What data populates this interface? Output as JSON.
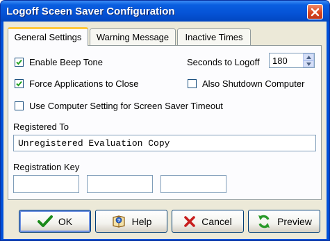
{
  "window": {
    "title": "Logoff Sceen Saver Configuration"
  },
  "tabs": [
    {
      "label": "General Settings",
      "active": true
    },
    {
      "label": "Warning Message",
      "active": false
    },
    {
      "label": "Inactive Times",
      "active": false
    }
  ],
  "general": {
    "enable_beep": {
      "label": "Enable Beep Tone",
      "checked": true
    },
    "force_close": {
      "label": "Force Applications to Close",
      "checked": true
    },
    "use_computer_setting": {
      "label": "Use Computer Setting for Screen Saver Timeout",
      "checked": false
    },
    "also_shutdown": {
      "label": "Also Shutdown Computer",
      "checked": false
    },
    "seconds_label": "Seconds to Logoff",
    "seconds_value": "180",
    "registered_to_label": "Registered To",
    "registered_to_value": "Unregistered Evaluation Copy",
    "registration_key_label": "Registration Key",
    "registration_key_values": [
      "",
      "",
      ""
    ]
  },
  "buttons": {
    "ok": "OK",
    "help": "Help",
    "cancel": "Cancel",
    "preview": "Preview"
  },
  "icons": {
    "close": "close-icon",
    "ok": "checkmark-icon",
    "help": "help-icon",
    "cancel": "x-icon",
    "preview": "refresh-icon"
  },
  "colors": {
    "titlebar": "#0553d6",
    "client_bg": "#ece9d8",
    "tab_highlight": "#ffc83c",
    "close_button": "#d9441e",
    "ok_icon": "#1a8a1a",
    "cancel_icon": "#c81e1e",
    "preview_icon": "#2a9a2a"
  }
}
